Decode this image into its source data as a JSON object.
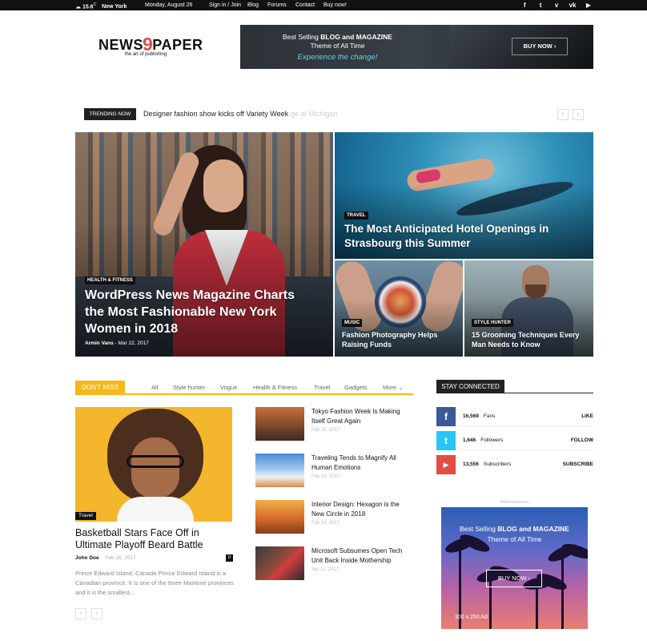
{
  "topbar": {
    "temp": "15.6",
    "temp_unit": "C",
    "city": "New York",
    "date": "Monday, August 26",
    "links": [
      "Sign in / Join",
      "Blog",
      "Forums",
      "Contact",
      "Buy now!"
    ],
    "social_icons": [
      "facebook-icon",
      "twitter-icon",
      "vimeo-icon",
      "vk-icon",
      "youtube-icon"
    ]
  },
  "logo": {
    "left": "NEWS",
    "nine": "9",
    "right": "PAPER",
    "tagline": "the art of publishing"
  },
  "header_banner": {
    "line1_prefix": "Best Selling ",
    "line1_bold": "BLOG and MAGAZINE",
    "line2": "Theme of All Time",
    "line3": "Experience the change!",
    "button": "BUY NOW"
  },
  "trending": {
    "label": "TRENDING NOW",
    "headline": "Designer fashion show kicks off Variety Week",
    "ghost": "ge at Michigan",
    "prev": "‹",
    "next": "›"
  },
  "featured": [
    {
      "category": "HEALTH & FITNESS",
      "title": "WordPress News Magazine Charts the Most Fashionable New York Women in 2018",
      "author": "Armin Vans",
      "date": "Mar 22, 2017"
    },
    {
      "category": "TRAVEL",
      "title": "The Most Anticipated Hotel Openings in Strasbourg this Summer"
    },
    {
      "category": "MUSIC",
      "title": "Fashion Photography Helps Raising Funds"
    },
    {
      "category": "STYLE HUNTER",
      "title": "15 Grooming Techniques Every Man Needs to Know"
    }
  ],
  "dont_miss": {
    "label": "DON'T MISS",
    "tabs": [
      "All",
      "Style hunter",
      "Vogue",
      "Health & Fitness",
      "Travel",
      "Gadgets",
      "More"
    ],
    "big": {
      "category": "Travel",
      "title": "Basketball Stars Face Off in Ultimate Playoff Beard Battle",
      "author": "John Doe",
      "date": "Feb 26, 2017",
      "comments": "0",
      "excerpt": "Prince Edward Island, Canada Prince Edward Island is a Canadian province. It is one of the three Maritime provinces and it is the smallest..."
    },
    "list": [
      {
        "title": "Tokyo Fashion Week Is Making Itself Great Again",
        "date": "Feb 25, 2017"
      },
      {
        "title": "Traveling Tends to Magnify All Human Emotions",
        "date": "Feb 23, 2017"
      },
      {
        "title": "Interior Design: Hexagon is the New Circle in 2018",
        "date": "Feb 24, 2017"
      },
      {
        "title": "Microsoft Subsumes Open Tech Unit Back Inside Mothership",
        "date": "Apr 11, 2017"
      }
    ],
    "pager_prev": "‹",
    "pager_next": "›"
  },
  "stay_connected": {
    "label": "STAY CONNECTED",
    "rows": [
      {
        "icon": "facebook-icon",
        "glyph": "f",
        "color": "#3b5998",
        "count": "16,569",
        "unit": "Fans",
        "action": "LIKE"
      },
      {
        "icon": "twitter-icon",
        "glyph": "t",
        "color": "#29c5f6",
        "count": "1,646",
        "unit": "Followers",
        "action": "FOLLOW"
      },
      {
        "icon": "youtube-icon",
        "glyph": "▶",
        "color": "#e14e42",
        "count": "13,556",
        "unit": "Subscribers",
        "action": "SUBSCRIBE"
      }
    ]
  },
  "sidebar_ad": {
    "label": "- Advertisement -",
    "line1_prefix": "Best Selling ",
    "line1_bold": "BLOG and MAGAZINE",
    "line2": "Theme of All Time",
    "button": "BUY NOW",
    "size": "300 x 250 Ad"
  },
  "colors": {
    "accent": "#f5b71a",
    "dark": "#111111",
    "logo_nine": "#e04b4b",
    "banner_cyan": "#64d4e2"
  }
}
